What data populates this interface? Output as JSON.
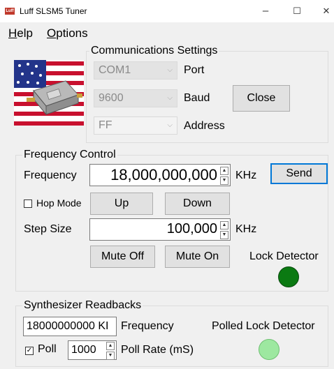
{
  "window": {
    "title": "Luff SLSM5 Tuner",
    "app_icon_text": "Luff",
    "minimize_glyph": "–",
    "maximize_glyph": "☐",
    "close_glyph": "✕"
  },
  "menu": {
    "help_prefix": "H",
    "help_rest": "elp",
    "options_prefix": "O",
    "options_rest": "ptions"
  },
  "communications": {
    "title": "Communications Settings",
    "port_value": "COM1",
    "port_label": "Port",
    "baud_value": "9600",
    "baud_label": "Baud",
    "address_value": "FF",
    "address_label": "Address",
    "close_button": "Close"
  },
  "frequency_control": {
    "title": "Frequency Control",
    "frequency_label": "Frequency",
    "frequency_value": "18,000,000,000",
    "frequency_unit": "KHz",
    "send_button": "Send",
    "hop_mode_label": "Hop Mode",
    "hop_mode_checked": false,
    "up_button": "Up",
    "down_button": "Down",
    "step_size_label": "Step Size",
    "step_size_value": "100,000",
    "step_size_unit": "KHz",
    "mute_off_button": "Mute Off",
    "mute_on_button": "Mute On",
    "lock_detector_label": "Lock Detector",
    "lock_detector_color": "#0b7a12"
  },
  "synthesizer": {
    "title": "Synthesizer Readbacks",
    "frequency_readback": "18000000000 KI",
    "frequency_label": "Frequency",
    "polled_lock_label": "Polled Lock Detector",
    "polled_lock_color": "#9de8a0",
    "poll_label": "Poll",
    "poll_checked": true,
    "poll_rate_value": "1000",
    "poll_rate_label": "Poll Rate (mS)"
  },
  "colors": {
    "accent": "#0078d7"
  }
}
